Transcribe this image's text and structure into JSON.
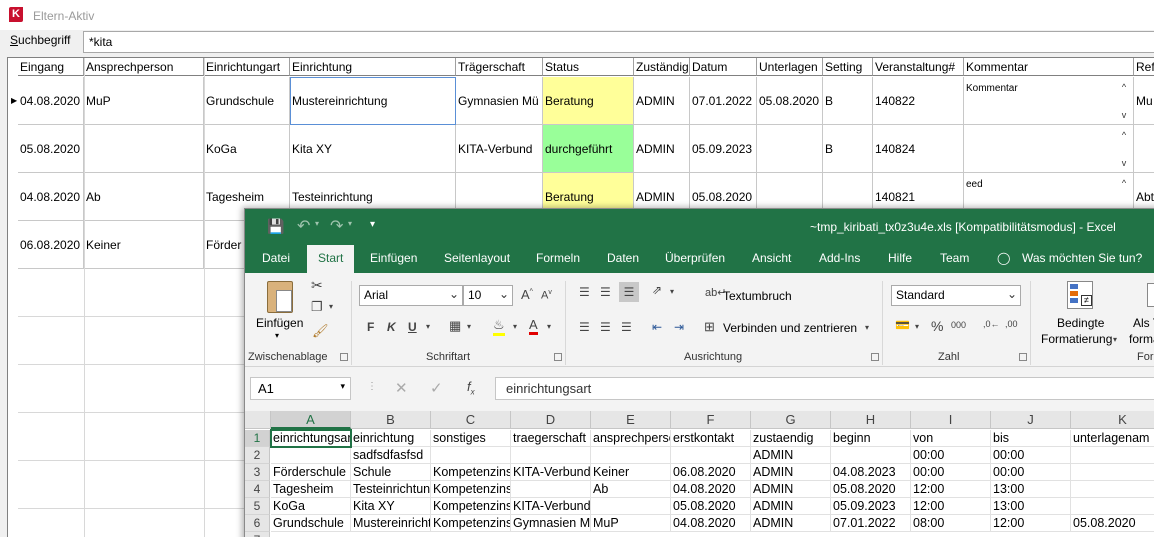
{
  "app": {
    "title": "Eltern-Aktiv"
  },
  "search": {
    "label": "Suchbegriff",
    "value": "*kita"
  },
  "grid": {
    "columns": [
      "Eingang",
      "Ansprechperson",
      "Einrichtungart",
      "Einrichtung",
      "Trägerschaft",
      "Status",
      "Zuständig",
      "Datum",
      "Unterlagen",
      "Setting",
      "Veranstaltung#",
      "Kommentar",
      "Ref"
    ],
    "rows": [
      {
        "eingang": "04.08.2020",
        "ansprechperson": "MuP",
        "einrichtungart": "Grundschule",
        "einrichtung": "Mustereinrichtung",
        "traeger": "Gymnasien Mü",
        "status": "Beratung",
        "zustaendig": "ADMIN",
        "datum": "07.01.2022",
        "unterlagen": "05.08.2020",
        "setting": "B",
        "veranstaltung": "140822",
        "kommentar": "Kommentar",
        "ref": "Mu"
      },
      {
        "eingang": "05.08.2020",
        "ansprechperson": "",
        "einrichtungart": "KoGa",
        "einrichtung": "Kita XY",
        "traeger": "KITA-Verbund",
        "status": "durchgeführt",
        "zustaendig": "ADMIN",
        "datum": "05.09.2023",
        "unterlagen": "",
        "setting": "B",
        "veranstaltung": "140824",
        "kommentar": "",
        "ref": ""
      },
      {
        "eingang": "04.08.2020",
        "ansprechperson": "Ab",
        "einrichtungart": "Tagesheim",
        "einrichtung": "Testeinrichtung",
        "traeger": "",
        "status": "Beratung",
        "zustaendig": "ADMIN",
        "datum": "05.08.2020",
        "unterlagen": "",
        "setting": "",
        "veranstaltung": "140821",
        "kommentar": "eed",
        "ref": "Abt"
      },
      {
        "eingang": "06.08.2020",
        "ansprechperson": "Keiner",
        "einrichtungart": "Förder",
        "einrichtung": "",
        "traeger": "",
        "status": "",
        "zustaendig": "",
        "datum": "",
        "unterlagen": "",
        "setting": "",
        "veranstaltung": "",
        "kommentar": "",
        "ref": ""
      }
    ]
  },
  "excel": {
    "title": "~tmp_kiribati_tx0z3u4e.xls  [Kompatibilitätsmodus]  -  Excel",
    "tabs": [
      "Datei",
      "Start",
      "Einfügen",
      "Seitenlayout",
      "Formeln",
      "Daten",
      "Überprüfen",
      "Ansicht",
      "Add-Ins",
      "Hilfe",
      "Team"
    ],
    "tell_me": "Was möchten Sie tun?",
    "ribbon": {
      "paste_label": "Einfügen",
      "clipboard": "Zwischenablage",
      "font_name": "Arial",
      "font_size": "10",
      "font_group": "Schriftart",
      "bold": "F",
      "italic": "K",
      "underline": "U",
      "wrap_text": "Textumbruch",
      "merge_center": "Verbinden und zentrieren",
      "alignment": "Ausrichtung",
      "number_format": "Standard",
      "number_group": "Zahl",
      "cond_format_1": "Bedingte",
      "cond_format_2": "Formatierung",
      "as_table_1": "Als T",
      "as_table_2": "forma",
      "styles_group": "For"
    },
    "name_box": "A1",
    "formula": "einrichtungsart",
    "col_headers": [
      "A",
      "B",
      "C",
      "D",
      "E",
      "F",
      "G",
      "H",
      "I",
      "J",
      "K"
    ],
    "rows": [
      [
        "einrichtungsart",
        "einrichtung",
        "sonstiges",
        "traegerschaft",
        "ansprechperson",
        "erstkontakt",
        "zustaendig",
        "beginn",
        "von",
        "bis",
        "unterlagenam"
      ],
      [
        "",
        "sadfsdfasfsd",
        "",
        "",
        "",
        "",
        "ADMIN",
        "",
        "00:00",
        "00:00",
        ""
      ],
      [
        "Förderschule",
        "Schule",
        "Kompetenzinsel",
        "KITA-Verbund",
        "Keiner",
        "06.08.2020",
        "ADMIN",
        "04.08.2023",
        "00:00",
        "00:00",
        ""
      ],
      [
        "Tagesheim",
        "Testeinrichtung",
        "Kompetenzinsel",
        "",
        "Ab",
        "04.08.2020",
        "ADMIN",
        "05.08.2020",
        "12:00",
        "13:00",
        ""
      ],
      [
        "KoGa",
        "Kita XY",
        "Kompetenzinsel",
        "KITA-Verbund",
        "",
        "05.08.2020",
        "ADMIN",
        "05.09.2023",
        "12:00",
        "13:00",
        ""
      ],
      [
        "Grundschule",
        "Mustereinrichtung",
        "Kompetenzinsel",
        "Gymnasien Mü",
        "MuP",
        "04.08.2020",
        "ADMIN",
        "07.01.2022",
        "08:00",
        "12:00",
        "05.08.2020"
      ]
    ],
    "row7": "7"
  }
}
